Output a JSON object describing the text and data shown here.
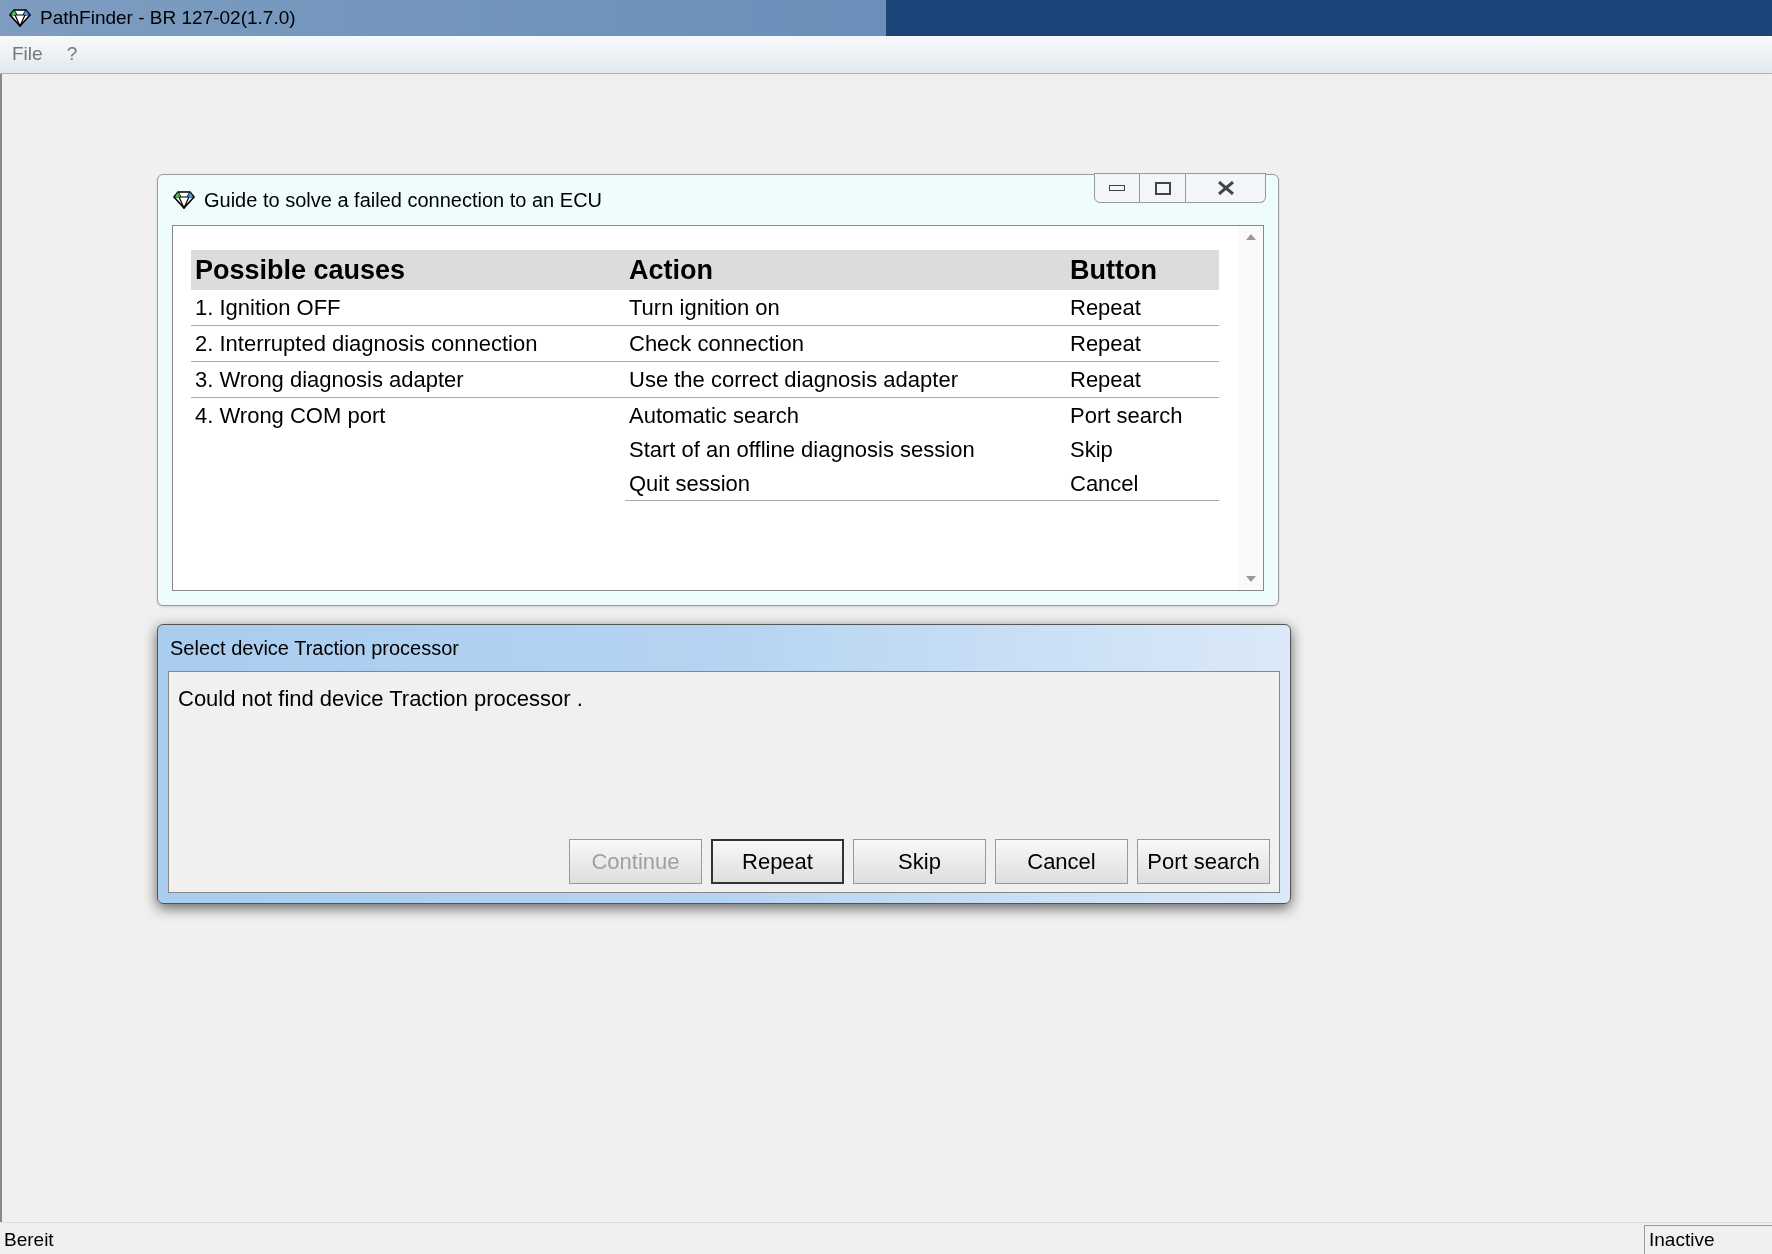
{
  "window": {
    "title": "PathFinder - BR 127-02(1.7.0)"
  },
  "menu": [
    "File",
    "?"
  ],
  "guide": {
    "title": "Guide to solve a failed connection to an ECU",
    "columns": [
      "Possible causes",
      "Action",
      "Button"
    ],
    "rows": [
      {
        "cause": "1. Ignition OFF",
        "actions": [
          {
            "action": "Turn ignition on",
            "button": "Repeat"
          }
        ]
      },
      {
        "cause": "2. Interrupted diagnosis connection",
        "actions": [
          {
            "action": "Check connection",
            "button": "Repeat"
          }
        ]
      },
      {
        "cause": "3. Wrong diagnosis adapter",
        "actions": [
          {
            "action": "Use the correct diagnosis adapter",
            "button": "Repeat"
          }
        ]
      },
      {
        "cause": "4. Wrong COM port",
        "actions": [
          {
            "action": "Automatic search",
            "button": "Port search"
          },
          {
            "action": "Start of an offline diagnosis session",
            "button": "Skip"
          },
          {
            "action": "Quit session",
            "button": "Cancel"
          }
        ]
      }
    ]
  },
  "dialog": {
    "title": "Select device Traction processor",
    "message": "Could not find device Traction processor .",
    "buttons": [
      {
        "label": "Continue",
        "disabled": true,
        "default": false
      },
      {
        "label": "Repeat",
        "disabled": false,
        "default": true
      },
      {
        "label": "Skip",
        "disabled": false,
        "default": false
      },
      {
        "label": "Cancel",
        "disabled": false,
        "default": false
      },
      {
        "label": "Port search",
        "disabled": false,
        "default": false
      }
    ]
  },
  "status_bar": {
    "left": "Bereit",
    "right": "Inactive"
  }
}
